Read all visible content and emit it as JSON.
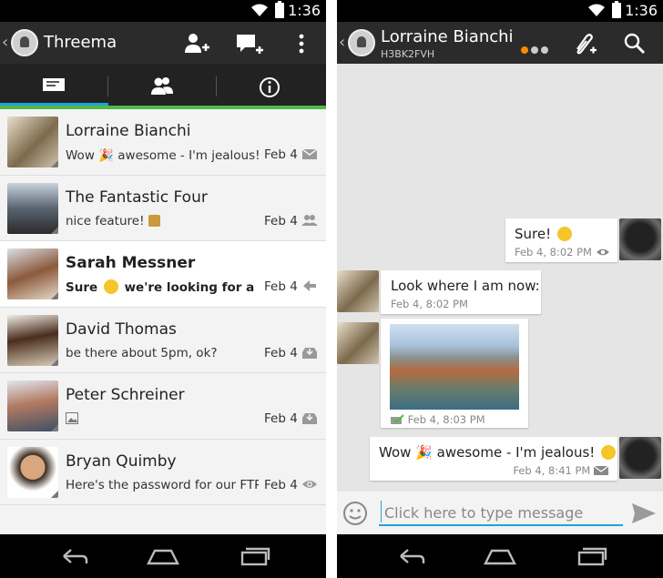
{
  "status_bar": {
    "time": "1:36"
  },
  "left": {
    "app_title": "Threema",
    "tabs": [
      {
        "name": "messages",
        "icon": "message-icon",
        "selected": true
      },
      {
        "name": "contacts",
        "icon": "people-icon",
        "selected": false
      },
      {
        "name": "info",
        "icon": "info-icon",
        "selected": false
      }
    ],
    "conversations": [
      {
        "name": "Lorraine Bianchi",
        "preview_a": "Wow",
        "preview_b": "awesome - I'm jealous!",
        "date": "Feb 4",
        "status_icon": "envelope-icon",
        "unread": false
      },
      {
        "name": "The Fantastic Four",
        "preview_a": "nice feature!",
        "preview_b": "",
        "date": "Feb 4",
        "status_icon": "group-icon",
        "unread": false
      },
      {
        "name": "Sarah Messner",
        "preview_a": "Sure",
        "preview_b": "we're looking for a good...",
        "date": "Feb 4",
        "status_icon": "reply-arrow-icon",
        "unread": true
      },
      {
        "name": "David Thomas",
        "preview_a": "be there about 5pm, ok?",
        "preview_b": "",
        "date": "Feb 4",
        "status_icon": "inbox-icon",
        "unread": false
      },
      {
        "name": "Peter Schreiner",
        "preview_a": "",
        "preview_b": "",
        "date": "Feb 4",
        "status_icon": "inbox-icon",
        "unread": false
      },
      {
        "name": "Bryan Quimby",
        "preview_a": "Here's the password for our FTP...",
        "preview_b": "",
        "date": "Feb 4",
        "status_icon": "eye-icon",
        "unread": false
      }
    ]
  },
  "right": {
    "contact_name": "Lorraine Bianchi",
    "contact_id": "H3BK2FVH",
    "trust_level_dots": [
      "#ff8a00",
      "#cccccc",
      "#cccccc"
    ],
    "messages": [
      {
        "direction": "out",
        "text": "Sure!",
        "meta": "Feb 4, 8:02 PM",
        "status_icon": "eye-icon"
      },
      {
        "direction": "in",
        "text": "Look where I am now:",
        "meta": "Feb 4, 8:02 PM"
      },
      {
        "direction": "in",
        "type": "image",
        "meta": "Feb 4, 8:03 PM",
        "status_icon": "ack-icon"
      },
      {
        "direction": "out",
        "text_a": "Wow",
        "text_b": "awesome - I'm jealous!",
        "meta": "Feb 4, 8:41 PM",
        "status_icon": "envelope-icon"
      }
    ],
    "composer": {
      "placeholder": "Click here to type message"
    }
  },
  "colors": {
    "accent": "#1fa3d9",
    "green": "#52b948",
    "actionbar": "#2b2b2b"
  }
}
